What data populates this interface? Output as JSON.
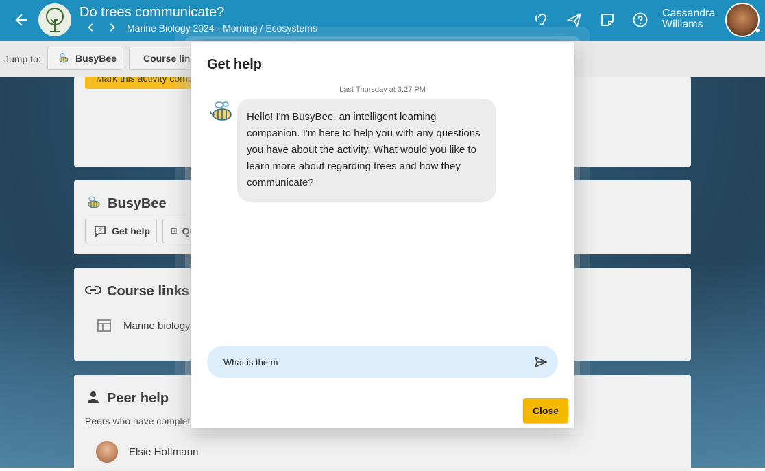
{
  "header": {
    "title": "Do trees communicate?",
    "breadcrumb": "Marine Biology 2024 - Morning / Ecosystems",
    "user_name_first": "Cassandra",
    "user_name_last": "Williams"
  },
  "jump_bar": {
    "label": "Jump to:",
    "buttons": [
      "BusyBee",
      "Course links"
    ]
  },
  "background_page": {
    "activity_banner": "Mark this activity complete",
    "busybee_card": {
      "title": "BusyBee",
      "buttons": [
        "Get help",
        "Quiz"
      ]
    },
    "course_links_card": {
      "title": "Course links",
      "link": "Marine biology"
    },
    "peer_help_card": {
      "title": "Peer help",
      "subtitle": "Peers who have completed",
      "peer_name": "Elsie Hoffmann"
    }
  },
  "dialog": {
    "title": "Get help",
    "timestamp": "Last Thursday at 3:27 PM",
    "message": "Hello! I'm BusyBee, an intelligent learning companion. I'm here to help you with any questions you have about the activity. What would you like to learn more about regarding trees and how they communicate?",
    "input_value": "What is the m",
    "close_label": "Close"
  },
  "colors": {
    "topbar": "#1f8fc0",
    "accent_yellow": "#f5b800",
    "input_bg": "#dcedfb"
  }
}
